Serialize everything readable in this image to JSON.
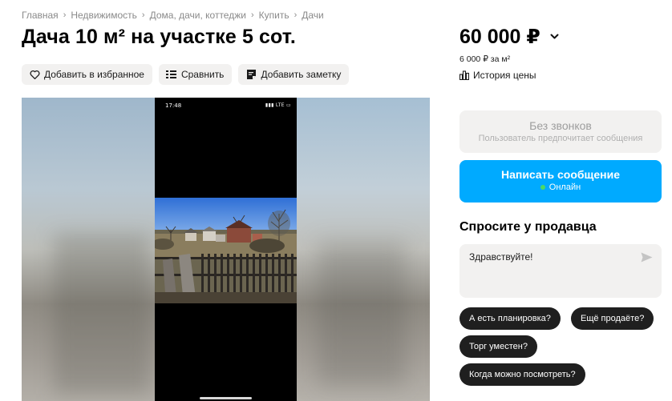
{
  "breadcrumb": [
    "Главная",
    "Недвижимость",
    "Дома, дачи, коттеджи",
    "Купить",
    "Дачи"
  ],
  "title": "Дача 10 м² на участке 5 сот.",
  "actions": {
    "favorite": "Добавить в избранное",
    "compare": "Сравнить",
    "note": "Добавить заметку"
  },
  "gallery": {
    "time": "17:48",
    "status": "LTE"
  },
  "price": {
    "value": "60 000 ₽",
    "per_unit": "6 000 ₽ за м²",
    "history": "История цены"
  },
  "contact": {
    "no_calls_title": "Без звонков",
    "no_calls_subtitle": "Пользователь предпочитает сообщения",
    "write_label": "Написать сообщение",
    "status": "Онлайн"
  },
  "ask": {
    "title": "Спросите у продавца",
    "message_value": "Здравствуйте!",
    "chips": [
      "А есть планировка?",
      "Ещё продаёте?",
      "Торг уместен?",
      "Когда можно посмотреть?"
    ]
  },
  "colors": {
    "accent": "#00aaff",
    "online": "#4cd964",
    "chip_bg": "#1f1f1f",
    "muted_bg": "#f2f1f0"
  }
}
